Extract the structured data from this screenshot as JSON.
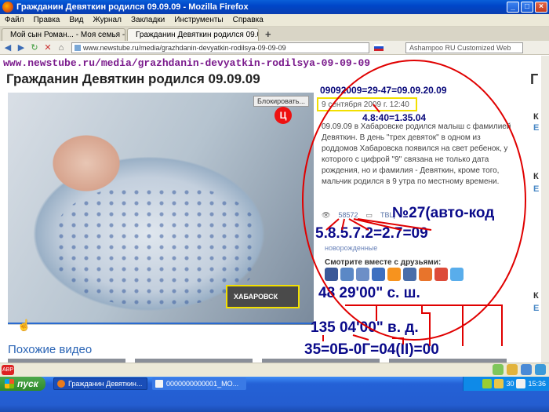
{
  "window": {
    "title": "Гражданин Девяткин родился 09.09.09 - Mozilla Firefox"
  },
  "menu": [
    "Файл",
    "Правка",
    "Вид",
    "Журнал",
    "Закладки",
    "Инструменты",
    "Справка"
  ],
  "tabs": [
    {
      "label": "Мой сын Роман... - Моя семья - Фотоал...",
      "active": false
    },
    {
      "label": "Гражданин Девяткин родился 09.09.09",
      "active": true
    }
  ],
  "nav": {
    "url": "www.newstube.ru/media/grazhdanin-devyatkin-rodilsya-09-09-09",
    "search_placeholder": "Ashampoo RU Customized Web"
  },
  "page": {
    "url_overlay": "www.newstube.ru/media/grazhdanin-devyatkin-rodilsya-09-09-09",
    "title": "Гражданин Девяткин родился 09.09.09",
    "block_label": "Блокировать...",
    "channel_logo": "Ц",
    "city_caption": "ХАБАРОВСК",
    "date": "9 сентября 2009 г. 12:40",
    "description": "09.09.09 в Хабаровске родился малыш с фамилией Девяткин. В день \"трех девяток\" в одном из роддомов Хабаровска появился на свет ребенок, у которого с цифрой \"9\" связана не только дата рождения, но и фамилия - Девяткин, кроме того, мальчик родился в 9 утра по местному времени.",
    "views": "58572",
    "channel": "ТВЦ",
    "tag": "новорожденные",
    "share_label": "Смотрите вместе с друзьями:",
    "similar_heading": "Похожие видео",
    "right_col": {
      "big": "Г",
      "letters": [
        "К",
        "Е",
        "К",
        "Е",
        "К",
        "Е"
      ]
    }
  },
  "annotations": {
    "eq1": "09092009=29-47=09.09.20.09",
    "time": "4.8:40=1.35.04",
    "auto": "№27(авто-код",
    "sum": "5.8.5.7.2=2.7=09",
    "lat": "48 29'00\" с. ш.",
    "lon": "135 04'00\" в. д.",
    "last": "35=0Б-0Г=04(II)=00",
    "color": "#0a0a8a",
    "circle_color": "#e00000",
    "highlight_color": "#f2df00"
  },
  "social_colors": [
    "#3b5998",
    "#5b88c6",
    "#6d8fc7",
    "#3e70c0",
    "#f7931e",
    "#4a6ea9",
    "#e8742b",
    "#dd4b39",
    "#59adeb"
  ],
  "statusbar": {
    "abp": "ABP"
  },
  "taskbar": {
    "start": "пуск",
    "tasks": [
      "Гражданин Девяткин...",
      "0000000000001_МО..."
    ],
    "tray_temp": "30",
    "clock": "15:36"
  }
}
